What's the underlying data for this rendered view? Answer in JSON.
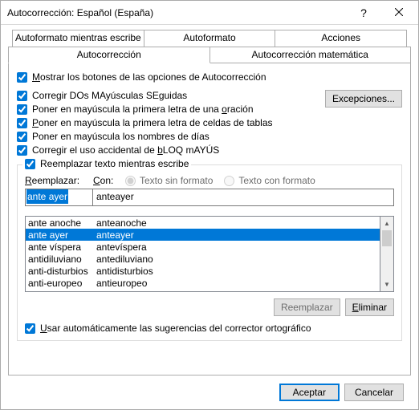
{
  "title": "Autocorrección: Español (España)",
  "tabs_row1": {
    "autoformat_type": "Autoformato mientras escribe",
    "autoformat": "Autoformato",
    "actions": "Acciones"
  },
  "tabs_row2": {
    "autocorrect": "Autocorrección",
    "math": "Autocorrección matemática"
  },
  "checks": {
    "show_buttons": "Mostrar los botones de las opciones de Autocorrección",
    "two_caps": "Corregir DOs MAyúsculas SEguidas",
    "first_sentence": "Poner en mayúscula la primera letra de una oración",
    "first_cell": "Poner en mayúscula la primera letra de celdas de tablas",
    "day_names": "Poner en mayúscula los nombres de días",
    "caps_lock": "Corregir el uso accidental de bLOQ mAYÚS"
  },
  "exceptions_btn": "Excepciones...",
  "replace_check": "Reemplazar texto mientras escribe",
  "col_replace_label": "Reemplazar:",
  "col_with_label": "Con:",
  "radio_plain": "Texto sin formato",
  "radio_format": "Texto con formato",
  "input_replace_value": "ante ayer",
  "input_with_value": "anteayer",
  "list": [
    {
      "from": "ante anoche",
      "to": "anteanoche"
    },
    {
      "from": "ante ayer",
      "to": "anteayer"
    },
    {
      "from": "ante víspera",
      "to": "antevíspera"
    },
    {
      "from": "antidiluviano",
      "to": "antediluviano"
    },
    {
      "from": "anti-disturbios",
      "to": "antidisturbios"
    },
    {
      "from": "anti-europeo",
      "to": "antieuropeo"
    }
  ],
  "selected_index": 1,
  "btn_replace": "Reemplazar",
  "btn_delete": "Eliminar",
  "use_suggestions": "Usar automáticamente las sugerencias del corrector ortográfico",
  "btn_ok": "Aceptar",
  "btn_cancel": "Cancelar"
}
